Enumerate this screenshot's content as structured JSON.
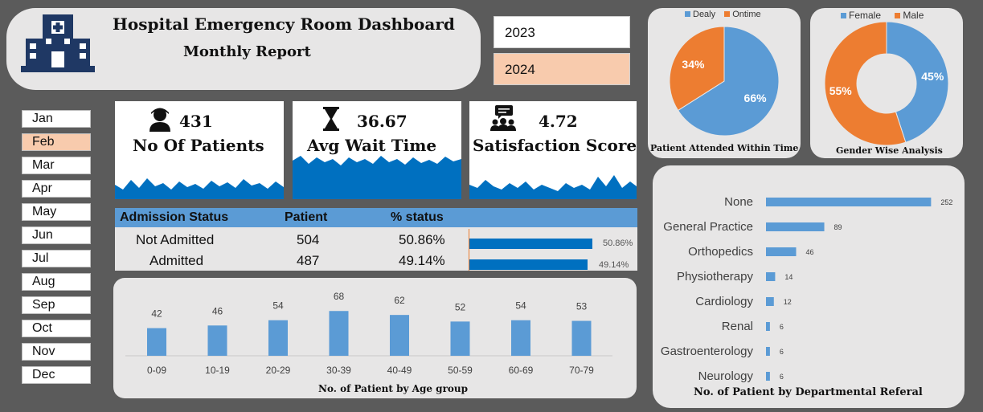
{
  "header": {
    "title": "Hospital Emergency Room Dashboard",
    "subtitle": "Monthly Report"
  },
  "years": [
    {
      "label": "2023",
      "selected": false
    },
    {
      "label": "2024",
      "selected": true
    }
  ],
  "months": [
    "Jan",
    "Feb",
    "Mar",
    "Apr",
    "May",
    "Jun",
    "Jul",
    "Aug",
    "Sep",
    "Oct",
    "Nov",
    "Dec"
  ],
  "selected_month": "Feb",
  "kpis": {
    "patients": {
      "value": "431",
      "label": "No Of Patients",
      "icon": "person-icon"
    },
    "wait": {
      "value": "36.67",
      "label": "Avg  Wait Time",
      "icon": "hourglass-icon"
    },
    "satisfaction": {
      "value": "4.72",
      "label": "Satisfaction Score",
      "icon": "group-chat-icon"
    }
  },
  "admission": {
    "headers": [
      "Admission Status",
      "Patient",
      "% status"
    ],
    "rows": [
      {
        "status": "Not Admitted",
        "patients": "504",
        "pct": "50.86%",
        "fraction": 0.5086
      },
      {
        "status": "Admitted",
        "patients": "487",
        "pct": "49.14%",
        "fraction": 0.4914
      }
    ]
  },
  "colors": {
    "accent": "#5b9bd5",
    "orange": "#ed7d31",
    "dark_blue": "#0070c0",
    "selected": "#f8cbad"
  },
  "chart_data": [
    {
      "type": "bar",
      "title": "No. of Patient by Age group",
      "categories": [
        "0-09",
        "10-19",
        "20-29",
        "30-39",
        "40-49",
        "50-59",
        "60-69",
        "70-79"
      ],
      "values": [
        42,
        46,
        54,
        68,
        62,
        52,
        54,
        53
      ],
      "grid": false
    },
    {
      "type": "pie",
      "title": "Patient Attended Within Time",
      "legend_position": "top",
      "labels": [
        "Dealy",
        "Ontime"
      ],
      "values": [
        66,
        34
      ],
      "value_labels": [
        "66%",
        "34%"
      ],
      "colors": [
        "#5b9bd5",
        "#ed7d31"
      ]
    },
    {
      "type": "pie",
      "subtype": "donut",
      "title": "Gender Wise Analysis",
      "legend_position": "top",
      "labels": [
        "Female",
        "Male"
      ],
      "values": [
        45,
        55
      ],
      "value_labels": [
        "45%",
        "55%"
      ],
      "colors": [
        "#5b9bd5",
        "#ed7d31"
      ]
    },
    {
      "type": "bar",
      "orientation": "horizontal",
      "title": "No. of Patient by Departmental Referal",
      "categories": [
        "None",
        "General Practice",
        "Orthopedics",
        "Physiotherapy",
        "Cardiology",
        "Renal",
        "Gastroenterology",
        "Neurology"
      ],
      "values": [
        252,
        89,
        46,
        14,
        12,
        6,
        6,
        6
      ]
    }
  ]
}
